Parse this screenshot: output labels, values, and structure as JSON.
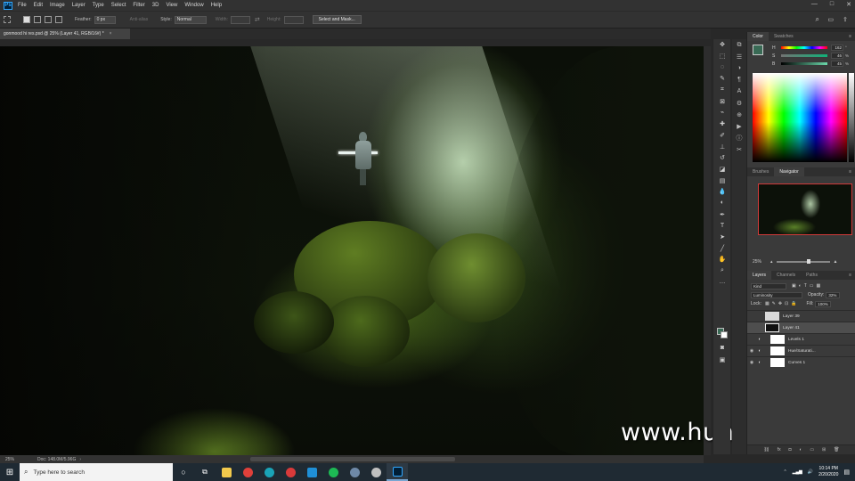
{
  "app": {
    "logo": "Ps",
    "menu": [
      "File",
      "Edit",
      "Image",
      "Layer",
      "Type",
      "Select",
      "Filter",
      "3D",
      "View",
      "Window",
      "Help"
    ],
    "window_controls": [
      "—",
      "□",
      "✕"
    ]
  },
  "options_bar": {
    "feather_label": "Feather:",
    "feather_value": "0 px",
    "antialias_label": "Anti-alias",
    "style_label": "Style:",
    "style_value": "Normal",
    "width_label": "Width:",
    "height_label": "Height:",
    "select_mask_label": "Select and Mask..."
  },
  "document": {
    "tab_title": "gonmood hi res.psd @ 25% (Layer 41, RGB/16#) *",
    "close_glyph": "×",
    "status_zoom": "25%",
    "status_doc": "Doc: 148.0M/5.96G"
  },
  "watermark": "www.hunls.com",
  "panels": {
    "color_tabs": [
      "Color",
      "Swatches"
    ],
    "color_sliders": [
      {
        "label": "H",
        "value": "162",
        "unit": "°"
      },
      {
        "label": "S",
        "value": "46",
        "unit": "%"
      },
      {
        "label": "B",
        "value": "45",
        "unit": "%"
      }
    ],
    "nav_tabs": [
      "Brushes",
      "Navigator"
    ],
    "navigator_zoom": "25%",
    "layers_tabs": [
      "Layers",
      "Channels",
      "Paths"
    ],
    "layers_kind": "Kind",
    "blend_mode": "Luminosity",
    "opacity_label": "Opacity:",
    "opacity_value": "32%",
    "lock_label": "Lock:",
    "fill_label": "Fill:",
    "fill_value": "100%",
    "layers": [
      {
        "name": "Layer 39",
        "selected": false,
        "eye": false
      },
      {
        "name": "Layer 41",
        "selected": true,
        "eye": false
      },
      {
        "name": "Levels 1",
        "selected": false,
        "eye": false
      },
      {
        "name": "Hue/Saturati...",
        "selected": false,
        "eye": true
      },
      {
        "name": "Curves 1",
        "selected": false,
        "eye": true
      }
    ]
  },
  "taskbar": {
    "search_placeholder": "Type here to search",
    "time": "10:14 PM",
    "date": "2/20/2020",
    "pinned_colors": [
      "#f2c94c",
      "#e0403a",
      "#1aa4b8",
      "#d93a3a",
      "#1f8fd6",
      "#1db954",
      "#6e89a8",
      "#c0c0c0",
      "#31a8ff"
    ]
  },
  "colors": {
    "foreground": "#396a55",
    "background": "#ffffff",
    "navigator_frame": "#d23a3a"
  }
}
